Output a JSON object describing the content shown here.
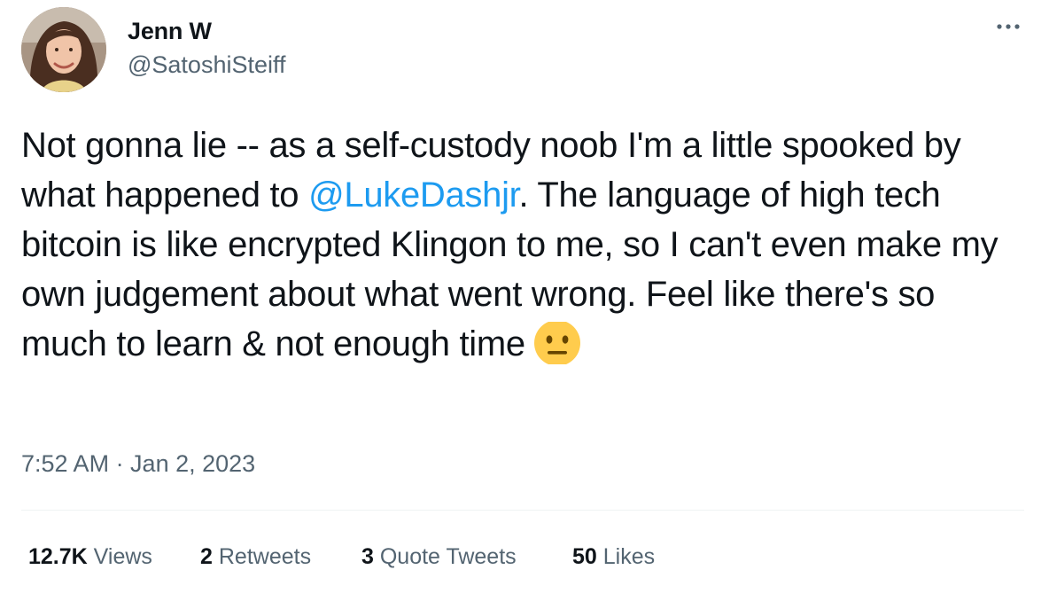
{
  "author": {
    "name": "Jenn W",
    "handle": "@SatoshiSteiff"
  },
  "tweet": {
    "text_before_mention": "Not gonna lie -- as a self-custody noob I'm a little spooked by what happened to ",
    "mention": "@LukeDashjr",
    "text_after_mention": ". The language of high tech bitcoin is like encrypted Klingon to me, so I can't even make my own judgement about what went wrong. Feel like there's so much to learn & not enough time",
    "emoji": "neutral-face-emoji"
  },
  "meta": {
    "timestamp": "7:52 AM · Jan 2, 2023"
  },
  "stats": {
    "views": {
      "count": "12.7K",
      "label": "Views"
    },
    "retweets": {
      "count": "2",
      "label": "Retweets"
    },
    "quote_tweets": {
      "count": "3",
      "label": "Quote Tweets"
    },
    "likes": {
      "count": "50",
      "label": "Likes"
    }
  },
  "colors": {
    "text": "#0f1419",
    "secondary": "#536471",
    "link": "#1d9bf0",
    "divider": "#eff3f4"
  },
  "icons": {
    "more": "more-options-icon"
  }
}
